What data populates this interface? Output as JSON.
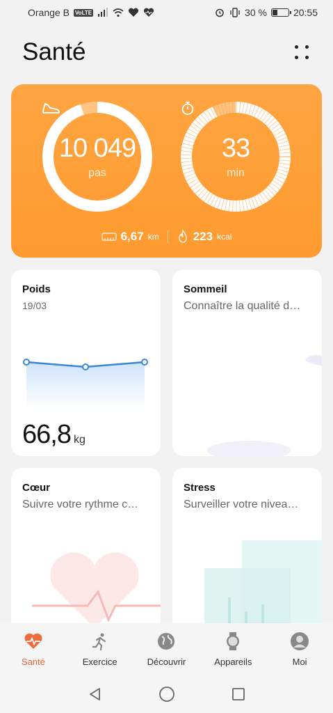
{
  "status_bar": {
    "carrier": "Orange B",
    "volte": "VoLTE",
    "battery_percent": "30 %",
    "time": "20:55"
  },
  "header": {
    "title": "Santé"
  },
  "summary": {
    "steps": {
      "value": "10 049",
      "unit": "pas",
      "progress": 0.95
    },
    "activity": {
      "value": "33",
      "unit": "min",
      "progress": 0.93
    },
    "distance": {
      "value": "6,67",
      "unit": "km"
    },
    "calories": {
      "value": "223",
      "unit": "kcal"
    }
  },
  "cards": {
    "weight": {
      "title": "Poids",
      "date": "19/03",
      "value": "66,8",
      "unit": "kg"
    },
    "sleep": {
      "title": "Sommeil",
      "subtitle": "Connaître la qualité d…"
    },
    "heart": {
      "title": "Cœur",
      "subtitle": "Suivre votre rythme c…"
    },
    "stress": {
      "title": "Stress",
      "subtitle": "Surveiller votre nivea…"
    }
  },
  "nav": {
    "items": [
      {
        "label": "Santé",
        "icon": "heart-icon",
        "active": true
      },
      {
        "label": "Exercice",
        "icon": "runner-icon",
        "active": false
      },
      {
        "label": "Découvrir",
        "icon": "globe-icon",
        "active": false
      },
      {
        "label": "Appareils",
        "icon": "watch-icon",
        "active": false
      },
      {
        "label": "Moi",
        "icon": "user-icon",
        "active": false
      }
    ]
  },
  "colors": {
    "accent": "#ff9a2f",
    "active_nav": "#e8633a"
  }
}
